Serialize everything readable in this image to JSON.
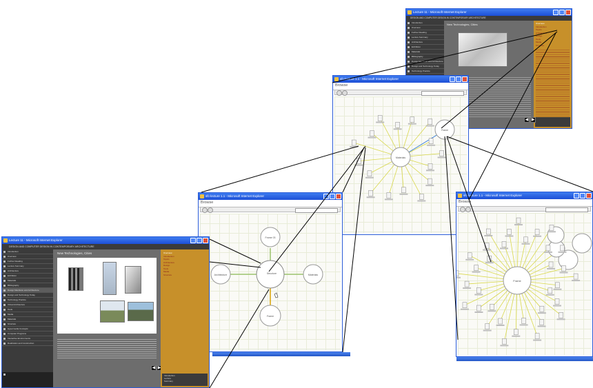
{
  "windows": {
    "app_main": {
      "title": "Lecture 11 - Microsoft Internet Explorer",
      "subtitle": "DESIGN AND COMPUTER DESIGN IN CONTEMPORARY ARCHITECTURE",
      "content_title": "New Technologies, Cities",
      "sidebar_items": [
        "Introduction",
        "Overview",
        "Further Reading",
        "Lecture Summary",
        "Architecture",
        "Exhibition",
        "Materials",
        "Bibliography",
        "Design Manifesto and Architecture",
        "Design and Technology Today",
        "Technology Practice",
        "Virtual Architecture",
        "Tools",
        "Media",
        "Materials",
        "Structure",
        "Hypermedia Concepts",
        "Computer Programs",
        "Interactive Environments",
        "Realization and Construction"
      ],
      "toc_items": [
        "Overview",
        "Introduction",
        "Topics",
        "Architecture",
        "Design",
        "Tools",
        "Media",
        "Structure"
      ],
      "footer_items": [
        "Introduction",
        "Lecture",
        "Summary"
      ]
    },
    "app_top": {
      "title": "Lecture 11 - Microsoft Internet Explorer",
      "subtitle": "DESIGN AND COMPUTER DESIGN IN CONTEMPORARY ARCHITECTURE",
      "content_title": "New Technologies, Cities"
    },
    "browser_1": {
      "title": "sfc-lecture 1.1 - Microsoft Internet Explorer",
      "heading": "Browse"
    },
    "browser_2": {
      "title": "sfc-lecture 1.1 - Microsoft Internet Explorer",
      "heading": "Browse"
    },
    "browser_3": {
      "title": "sfc-lecture 1.1 - Microsoft Internet Explorer",
      "heading": "Browse"
    }
  },
  "graph_labels": {
    "center": "Structure",
    "top": "Frame 03",
    "left": "Architecture",
    "right": "Materials",
    "bottom": "Frame",
    "browse_center": "Materials",
    "frame_node": "Frame"
  },
  "colors": {
    "title_blue": "#2a5bd7",
    "sidebar_dark": "#3b3b3b",
    "toc_tan": "#c7902a",
    "spoke_yellow": "#d9d84a",
    "link_green": "#9ac26a"
  }
}
